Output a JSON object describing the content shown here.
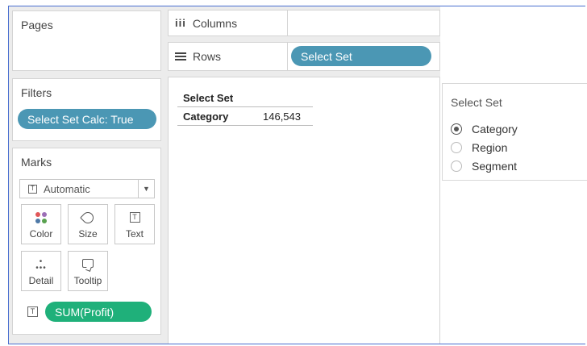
{
  "pages": {
    "title": "Pages"
  },
  "filters": {
    "title": "Filters",
    "pill": "Select Set Calc: True"
  },
  "marks": {
    "title": "Marks",
    "mark_type": "Automatic",
    "buttons": {
      "color": "Color",
      "size": "Size",
      "text": "Text",
      "detail": "Detail",
      "tooltip": "Tooltip"
    },
    "measure_pill": "SUM(Profit)",
    "colors": {
      "dot1": "#e15759",
      "dot2": "#9c6fb6",
      "dot3": "#4e79a7",
      "dot4": "#59a14f"
    }
  },
  "shelves": {
    "columns_label": "Columns",
    "rows_label": "Rows",
    "rows_pill": "Select Set"
  },
  "view": {
    "header": "Select Set",
    "row_label": "Category",
    "row_value": "146,543"
  },
  "parameter": {
    "title": "Select Set",
    "options": [
      {
        "label": "Category",
        "selected": true
      },
      {
        "label": "Region",
        "selected": false
      },
      {
        "label": "Segment",
        "selected": false
      }
    ]
  },
  "colors": {
    "pill_blue": "#4b97b4",
    "pill_green": "#1fb07a",
    "frame": "#4a6fd0"
  }
}
